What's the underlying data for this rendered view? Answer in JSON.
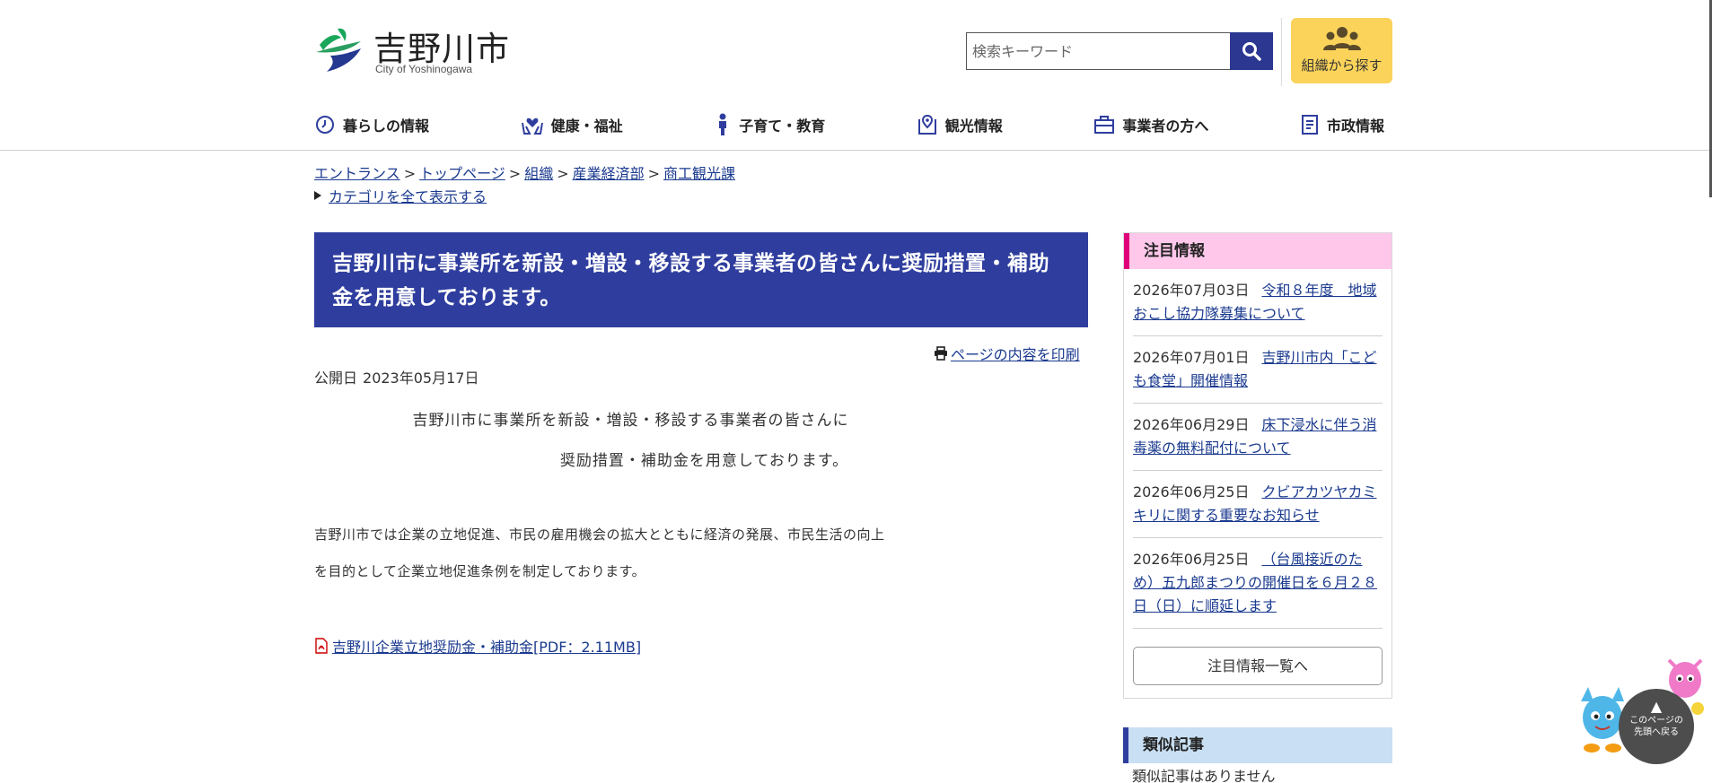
{
  "header": {
    "logo_title": "吉野川市",
    "logo_sub": "City of Yoshinogawa",
    "search_placeholder": "検索キーワード",
    "org_button_label": "組織から探す",
    "nav": [
      {
        "label": "暮らしの情報",
        "icon": "clock-icon"
      },
      {
        "label": "健康・福祉",
        "icon": "heart-hands-icon"
      },
      {
        "label": "子育て・教育",
        "icon": "child-icon"
      },
      {
        "label": "観光情報",
        "icon": "map-pin-icon"
      },
      {
        "label": "事業者の方へ",
        "icon": "briefcase-icon"
      },
      {
        "label": "市政情報",
        "icon": "document-icon"
      }
    ]
  },
  "breadcrumb": {
    "items": [
      "エントランス",
      "トップページ",
      "組織",
      "産業経済部",
      "商工観光課"
    ],
    "separator": ">",
    "category_toggle": "カテゴリを全て表示する"
  },
  "main": {
    "title": "吉野川市に事業所を新設・増設・移設する事業者の皆さんに奨励措置・補助金を用意しております。",
    "print_label": "ページの内容を印刷",
    "pubdate_label": "公開日",
    "pubdate_value": "2023年05月17日",
    "center_line_1": "吉野川市に事業所を新設・増設・移設する事業者の皆さんに",
    "center_line_2": "奨励措置・補助金を用意しております。",
    "body_line_1": "吉野川市では企業の立地促進、市民の雇用機会の拡大とともに経済の発展、市民生活の向上",
    "body_line_2": "を目的として企業立地促進条例を制定しております。",
    "pdf_link": "吉野川企業立地奨励金・補助金[PDF：2.11MB]"
  },
  "sidebar": {
    "featured_title": "注目情報",
    "news": [
      {
        "date": "2026年07月03日",
        "title": "令和８年度　地域おこし協力隊募集について"
      },
      {
        "date": "2026年07月01日",
        "title": "吉野川市内「こども食堂」開催情報"
      },
      {
        "date": "2026年06月29日",
        "title": "床下浸水に伴う消毒薬の無料配付について"
      },
      {
        "date": "2026年06月25日",
        "title": "クビアカツヤカミキリに関する重要なお知らせ"
      },
      {
        "date": "2026年06月25日",
        "title": "（台風接近のため）五九郎まつりの開催日を６月２８日（日）に順延します"
      }
    ],
    "more_label": "注目情報一覧へ",
    "similar_title": "類似記事",
    "similar_none": "類似記事はありません"
  },
  "totop": {
    "arrow": "▲",
    "line1": "このページの",
    "line2": "先頭へ戻る"
  },
  "colors": {
    "title_bg": "#2f3e9e",
    "search_button": "#2b3790",
    "org_button": "#fbd35a",
    "featured_head_bg": "#ffc8eb",
    "featured_accent": "#e0007a",
    "similar_head_bg": "#c9dff3",
    "link": "#1a3a8f"
  }
}
